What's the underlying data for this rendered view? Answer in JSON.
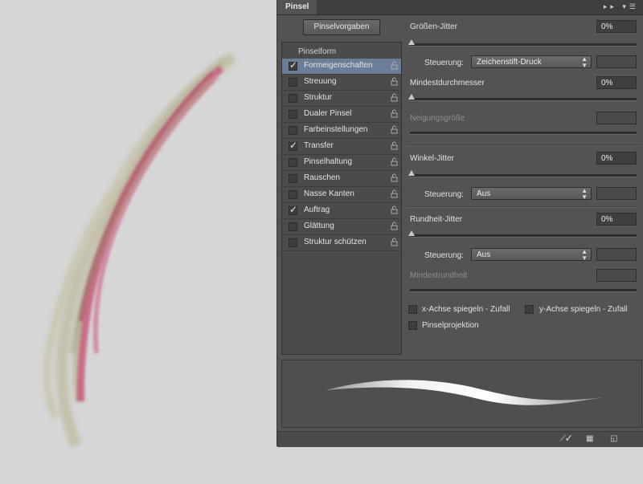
{
  "panel": {
    "tab_title": "Pinsel",
    "preset_button": "Pinselvorgaben",
    "section_title": "Pinselform",
    "items": [
      {
        "label": "Formeigenschaften",
        "checked": true,
        "selected": true
      },
      {
        "label": "Streuung",
        "checked": false
      },
      {
        "label": "Struktur",
        "checked": false
      },
      {
        "label": "Dualer Pinsel",
        "checked": false
      },
      {
        "label": "Farbeinstellungen",
        "checked": false
      },
      {
        "label": "Transfer",
        "checked": true
      },
      {
        "label": "Pinselhaltung",
        "checked": false
      },
      {
        "label": "Rauschen",
        "checked": false
      },
      {
        "label": "Nasse Kanten",
        "checked": false
      },
      {
        "label": "Auftrag",
        "checked": true
      },
      {
        "label": "Glättung",
        "checked": false
      },
      {
        "label": "Struktur schützen",
        "checked": false
      }
    ]
  },
  "settings": {
    "size_jitter": {
      "label": "Größen-Jitter",
      "value": "0%"
    },
    "size_control": {
      "label": "Steuerung:",
      "value": "Zeichenstift-Druck"
    },
    "min_diameter": {
      "label": "Mindestdurchmesser",
      "value": "0%"
    },
    "tilt_scale": {
      "label": "Neigungsgröße"
    },
    "angle_jitter": {
      "label": "Winkel-Jitter",
      "value": "0%"
    },
    "angle_control": {
      "label": "Steuerung:",
      "value": "Aus"
    },
    "roundness_jitter": {
      "label": "Rundheit-Jitter",
      "value": "0%"
    },
    "roundness_control": {
      "label": "Steuerung:",
      "value": "Aus"
    },
    "min_roundness": {
      "label": "Mindestrundheit"
    },
    "flip_x": "x-Achse spiegeln - Zufall",
    "flip_y": "y-Achse spiegeln - Zufall",
    "projection": "Pinselprojektion"
  },
  "icons": {
    "expand": "double-arrow-icon",
    "menu": "panel-menu-icon",
    "toggle_preview": "brush-toggle-icon",
    "grid": "grid-icon",
    "new_preset": "new-preset-icon"
  },
  "colors": {
    "panel_bg": "#535353",
    "selected_item": "#6a7f97",
    "canvas_bg": "#d6d6d6"
  }
}
